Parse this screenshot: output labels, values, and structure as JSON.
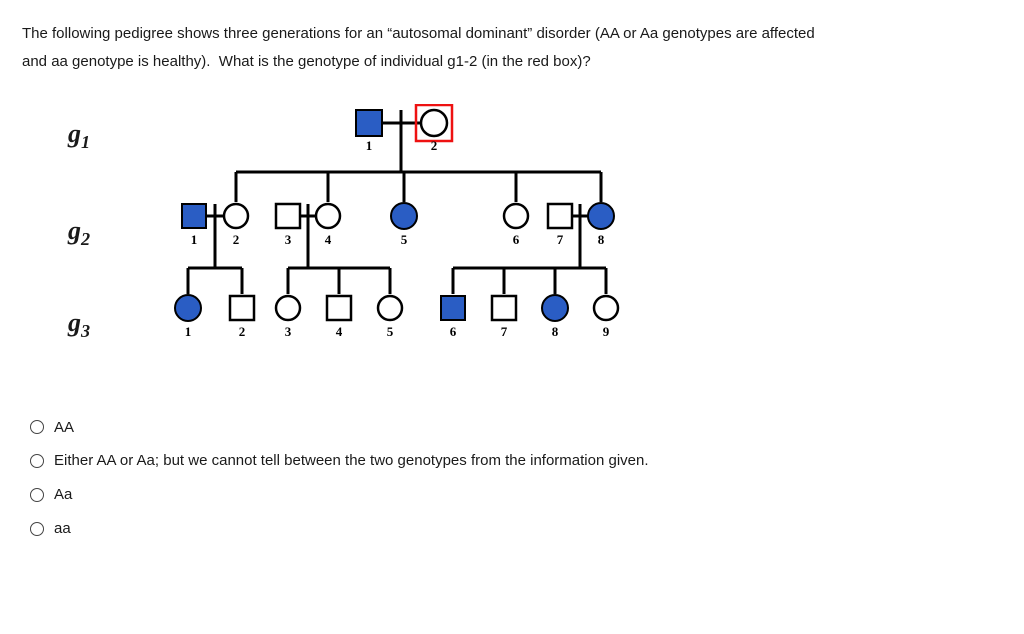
{
  "question": {
    "line1": "The following pedigree shows three generations for an “autosomal dominant” disorder (AA or Aa genotypes are affected",
    "line2": "and aa genotype is healthy).  What is the genotype of individual g1-2 (in the red box)?"
  },
  "gen": {
    "g1": "g",
    "g1s": "1",
    "g2": "g",
    "g2s": "2",
    "g3": "g",
    "g3s": "3"
  },
  "nums": {
    "g1_1": "1",
    "g1_2": "2",
    "g2_1": "1",
    "g2_2": "2",
    "g2_3": "3",
    "g2_4": "4",
    "g2_5": "5",
    "g2_6": "6",
    "g2_7": "7",
    "g2_8": "8",
    "g3_1": "1",
    "g3_2": "2",
    "g3_3": "3",
    "g3_4": "4",
    "g3_5": "5",
    "g3_6": "6",
    "g3_7": "7",
    "g3_8": "8",
    "g3_9": "9"
  },
  "options": {
    "a": "AA",
    "b": "Either AA or Aa; but we cannot tell between the two genotypes from the information given.",
    "c": "Aa",
    "d": "aa"
  }
}
